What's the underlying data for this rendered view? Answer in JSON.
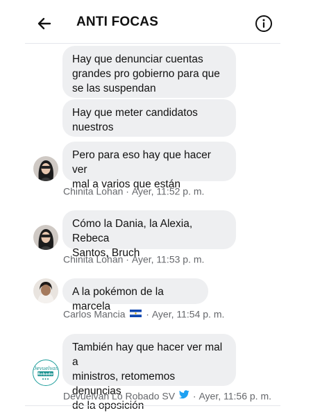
{
  "header": {
    "title": "ANTI FOCAS",
    "back_icon": "arrow-left-icon",
    "info_icon": "info-circle-icon"
  },
  "messages": [
    {
      "text": "Hay que denunciar cuentas\ngrandes pro gobierno para que\nse las suspendan"
    },
    {
      "text": "Hay que meter candidatos\nnuestros"
    },
    {
      "text": "Pero para eso hay que hacer ver\nmal a varios que están"
    },
    {
      "text": "Cómo la Dania, la Alexia, Rebeca\nSantos, Bruch"
    },
    {
      "text": "A la pokémon de la marcela"
    },
    {
      "text": "También hay que hacer ver mal a\nministros, retomemos denuncias\nde la oposición"
    }
  ],
  "meta": [
    {
      "sender": "Chinita Lohan",
      "sep": " · ",
      "time": "Ayer, 11:52 p. m."
    },
    {
      "sender": "Chinita Lohan",
      "sep": " · ",
      "time": "Ayer, 11:53 p. m."
    },
    {
      "sender": "Carlos Mancia",
      "sep": " · ",
      "time": "Ayer, 11:54 p. m.",
      "badge": "el-salvador-flag-icon"
    },
    {
      "sender": "Devuelvan Lo Robado SV",
      "sep": " · ",
      "time": "Ayer, 11:56 p. m.",
      "badge": "twitter-bird-icon"
    }
  ],
  "logo_text": "Devuelvan Lo Robado SV",
  "colors": {
    "bubble": "#eeeff1",
    "meta": "#65676b",
    "twitter": "#1da1f2",
    "flag_blue": "#0f47af"
  }
}
